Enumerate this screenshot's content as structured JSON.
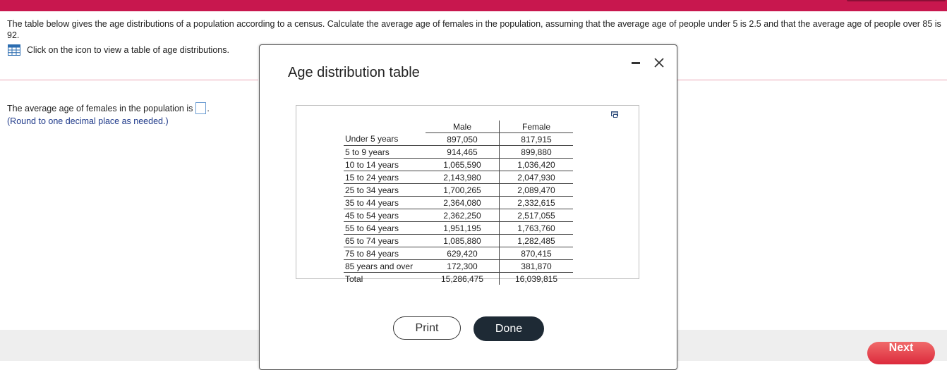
{
  "question": {
    "text": "The table below gives the age distributions of a population according to a census. Calculate the average age of females in the population, assuming that the average age of people under 5 is 2.5 and that the average age of people over 85 is 92.",
    "icon_link_text": "Click on the icon to view a table of age distributions."
  },
  "answer": {
    "prefix": "The average age of females in the population is",
    "value": "",
    "suffix": ".",
    "hint": "(Round to one decimal place as needed.)"
  },
  "dialog": {
    "title": "Age distribution table",
    "print_label": "Print",
    "done_label": "Done"
  },
  "table": {
    "headers": [
      "",
      "Male",
      "Female"
    ],
    "rows": [
      [
        "Under 5 years",
        "897,050",
        "817,915"
      ],
      [
        "5 to 9 years",
        "914,465",
        "899,880"
      ],
      [
        "10 to 14 years",
        "1,065,590",
        "1,036,420"
      ],
      [
        "15 to 24 years",
        "2,143,980",
        "2,047,930"
      ],
      [
        "25 to 34 years",
        "1,700,265",
        "2,089,470"
      ],
      [
        "35 to 44 years",
        "2,364,080",
        "2,332,615"
      ],
      [
        "45 to 54 years",
        "2,362,250",
        "2,517,055"
      ],
      [
        "55 to 64 years",
        "1,951,195",
        "1,763,760"
      ],
      [
        "65 to 74 years",
        "1,085,880",
        "1,282,485"
      ],
      [
        "75 to 84 years",
        "629,420",
        "870,415"
      ],
      [
        "85 years and over",
        "172,300",
        "381,870"
      ],
      [
        "Total",
        "15,286,475",
        "16,039,815"
      ]
    ]
  },
  "footer": {
    "next_label": "Next"
  },
  "colors": {
    "brand_bar": "#c8174e",
    "rule": "#e8a3b4",
    "hint_text": "#1f3a8a",
    "done_button": "#1e2a35",
    "next_button": "#dc2a3c"
  },
  "icons": [
    "table-icon",
    "minimize-icon",
    "close-icon",
    "copy-icon"
  ]
}
